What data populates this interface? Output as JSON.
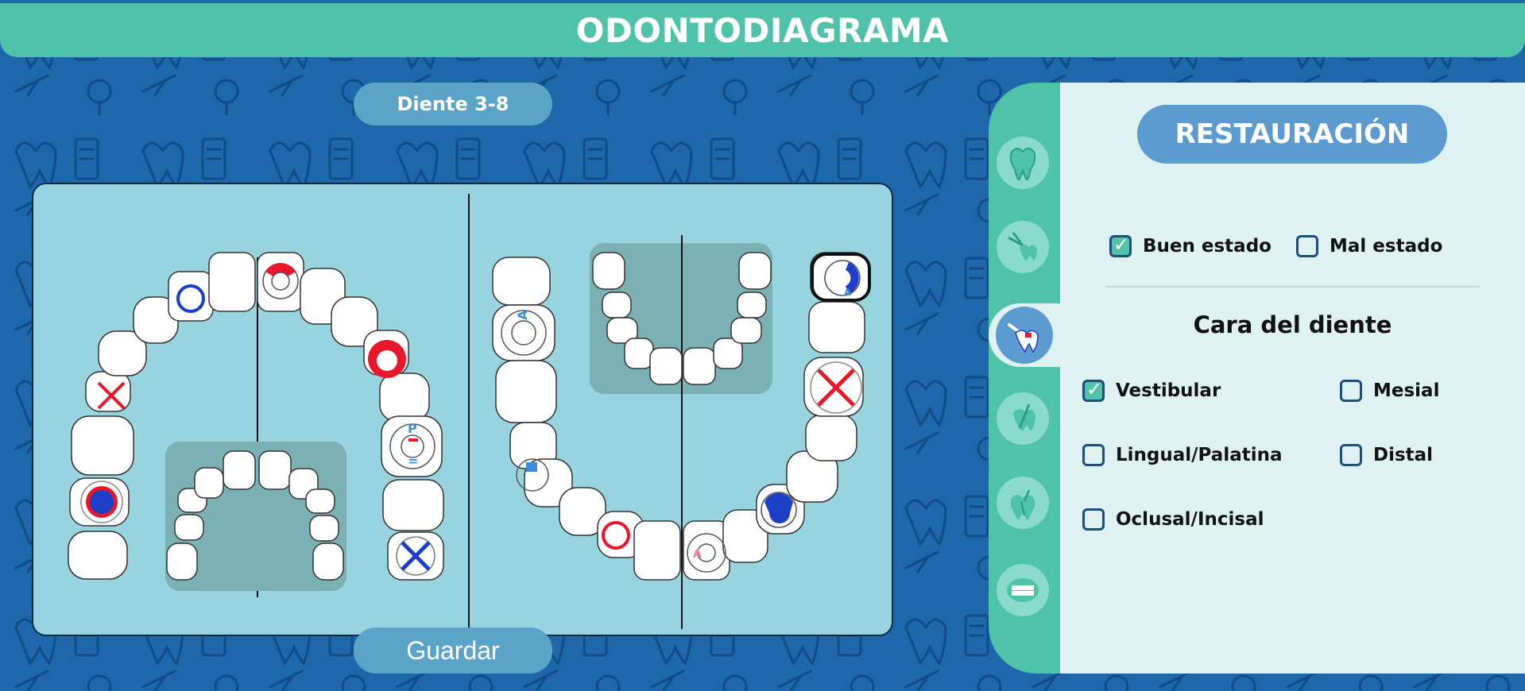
{
  "title": "ODONTODIAGRAMA",
  "tooth_label": "Diente 3-8",
  "save_label": "Guardar",
  "colors": {
    "background": "#1d67aa",
    "title_bar": "#4ec3a9",
    "chart_panel": "#98d4df",
    "right_panel": "#dff2f2",
    "accent_blue": "#5b9bd0",
    "mark_red": "#e8182a",
    "mark_blue": "#1d3ec7"
  },
  "side_tabs": [
    {
      "icon": "tooth-icon",
      "active": false
    },
    {
      "icon": "extraction-icon",
      "active": false
    },
    {
      "icon": "restoration-icon",
      "active": true
    },
    {
      "icon": "implant-icon",
      "active": false
    },
    {
      "icon": "root-canal-icon",
      "active": false
    },
    {
      "icon": "denture-icon",
      "active": false
    }
  ],
  "panel": {
    "section_label": "RESTAURACIÓN",
    "condition": [
      {
        "label": "Buen estado",
        "checked": true
      },
      {
        "label": "Mal estado",
        "checked": false
      }
    ],
    "face_title": "Cara del diente",
    "faces": [
      {
        "label": "Vestibular",
        "checked": true
      },
      {
        "label": "Mesial",
        "checked": false
      },
      {
        "label": "Lingual/Palatina",
        "checked": false
      },
      {
        "label": "Distal",
        "checked": false
      },
      {
        "label": "Oclusal/Incisal",
        "checked": false
      }
    ]
  }
}
